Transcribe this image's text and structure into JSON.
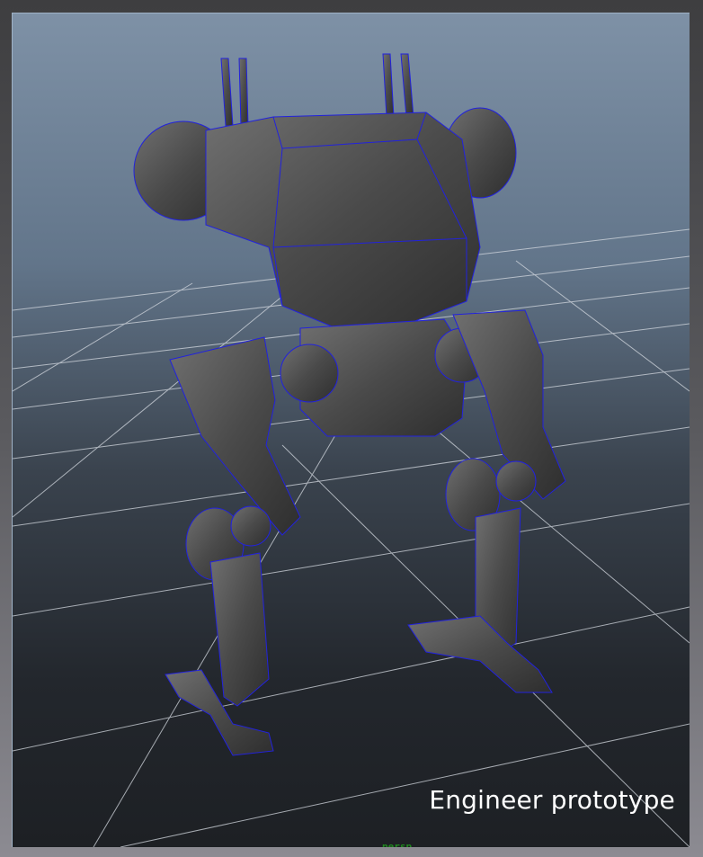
{
  "viewport": {
    "caption": "Engineer prototype",
    "camera_label": "persp"
  },
  "colors": {
    "wireframe": "#2222dd",
    "grid": "#d8dde4",
    "mesh": "#4a4a4a"
  }
}
